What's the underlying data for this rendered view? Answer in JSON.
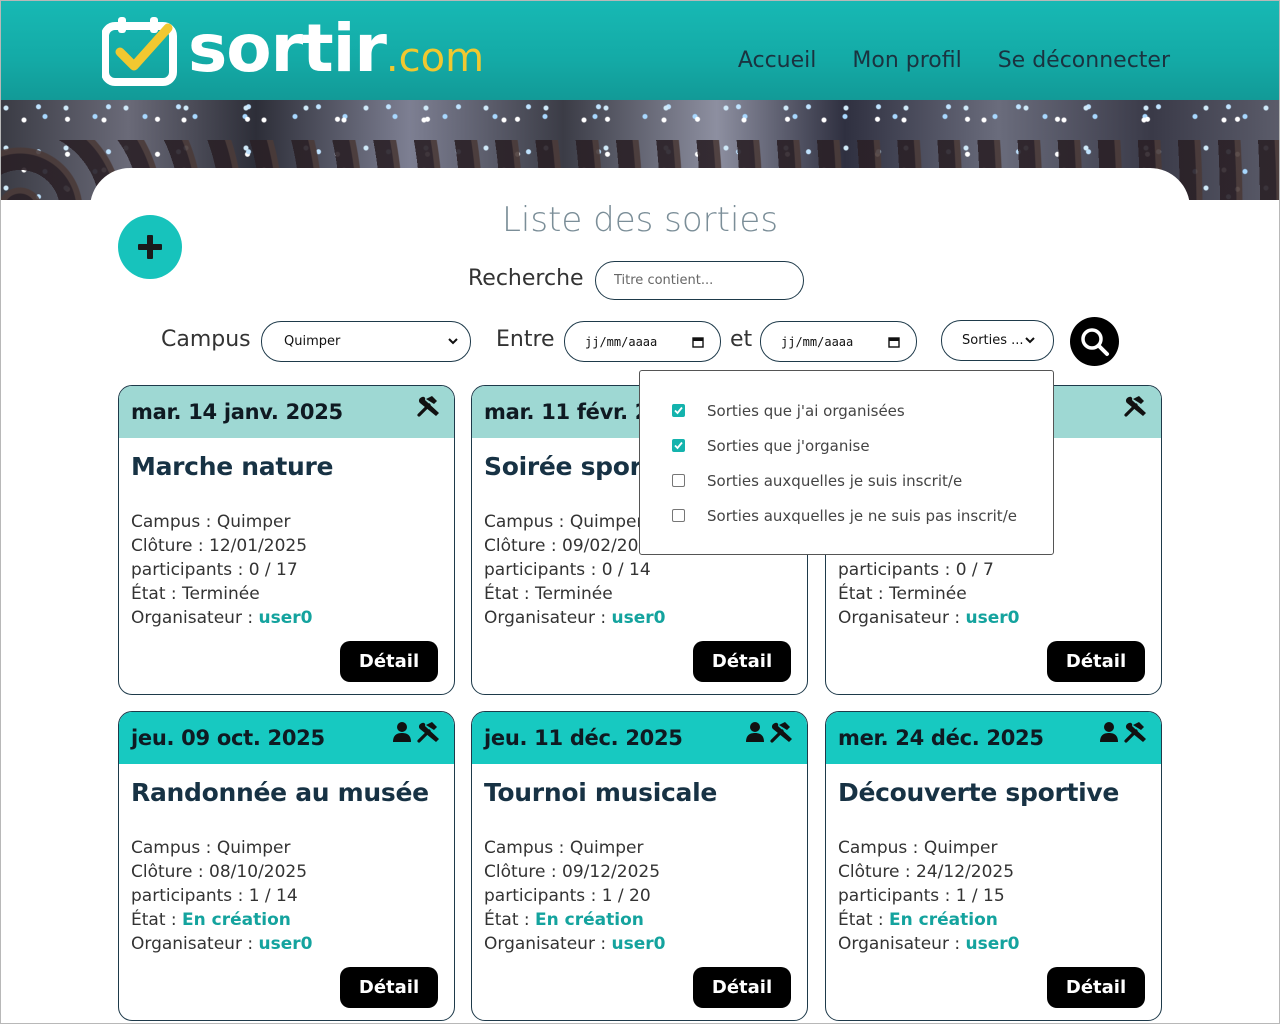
{
  "header": {
    "logo_text": "sortir",
    "logo_suffix": ".com",
    "nav": [
      "Accueil",
      "Mon profil",
      "Se déconnecter"
    ]
  },
  "page": {
    "title": "Liste des sorties",
    "add_icon": "plus-icon"
  },
  "filters": {
    "search_label": "Recherche",
    "search_placeholder": "Titre contient...",
    "campus_label": "Campus",
    "campus_value": "Quimper",
    "between_label": "Entre",
    "and_label": "et",
    "date_start_placeholder": "jj/mm/aaaa",
    "date_end_placeholder": "jj/mm/aaaa",
    "sorties_select": "Sorties ...",
    "search_icon": "magnifier-icon"
  },
  "dropdown": {
    "options": [
      {
        "label": "Sorties que j'ai organisées",
        "checked": true
      },
      {
        "label": "Sorties que j'organise",
        "checked": true
      },
      {
        "label": "Sorties auxquelles je suis inscrit/e",
        "checked": false
      },
      {
        "label": "Sorties auxquelles je ne suis pas inscrit/e",
        "checked": false
      }
    ]
  },
  "labels": {
    "campus": "Campus : ",
    "cloture": "Clôture : ",
    "participants": "participants : ",
    "etat": "État : ",
    "organisateur": "Organisateur : ",
    "detail": "Détail"
  },
  "cards": [
    {
      "date": "mar. 14 janv. 2025",
      "title": "Marche nature",
      "campus": "Quimper",
      "cloture": "12/01/2025",
      "participants": "0 / 17",
      "etat": "Terminée",
      "organisateur": "user0",
      "status": "past",
      "icons": [
        "tools-icon"
      ]
    },
    {
      "date": "mar. 11 févr. 2025",
      "title": "Soirée sportive",
      "campus": "Quimper",
      "cloture": "09/02/2025",
      "participants": "0 / 14",
      "etat": "Terminée",
      "organisateur": "user0",
      "status": "past",
      "icons": [
        "tools-icon"
      ]
    },
    {
      "date": "",
      "title": "",
      "campus": "",
      "cloture": "",
      "participants": "0 / 7",
      "etat": "Terminée",
      "organisateur": "user0",
      "status": "past",
      "icons": [
        "tools-icon"
      ]
    },
    {
      "date": "jeu. 09 oct. 2025",
      "title": "Randonnée au musée",
      "campus": "Quimper",
      "cloture": "08/10/2025",
      "participants": "1 / 14",
      "etat": "En création",
      "organisateur": "user0",
      "status": "open",
      "icons": [
        "user-icon",
        "tools-icon"
      ]
    },
    {
      "date": "jeu. 11 déc. 2025",
      "title": "Tournoi musicale",
      "campus": "Quimper",
      "cloture": "09/12/2025",
      "participants": "1 / 20",
      "etat": "En création",
      "organisateur": "user0",
      "status": "open",
      "icons": [
        "user-icon",
        "tools-icon"
      ]
    },
    {
      "date": "mer. 24 déc. 2025",
      "title": "Découverte sportive",
      "campus": "Quimper",
      "cloture": "24/12/2025",
      "participants": "1 / 15",
      "etat": "En création",
      "organisateur": "user0",
      "status": "open",
      "icons": [
        "user-icon",
        "tools-icon"
      ]
    }
  ],
  "colors": {
    "brand_teal": "#17c3bc",
    "logo_yellow": "#f1c830",
    "card_head_past": "#9ed8d3",
    "card_head_open": "#17c9c1",
    "link_teal": "#14a39e"
  }
}
